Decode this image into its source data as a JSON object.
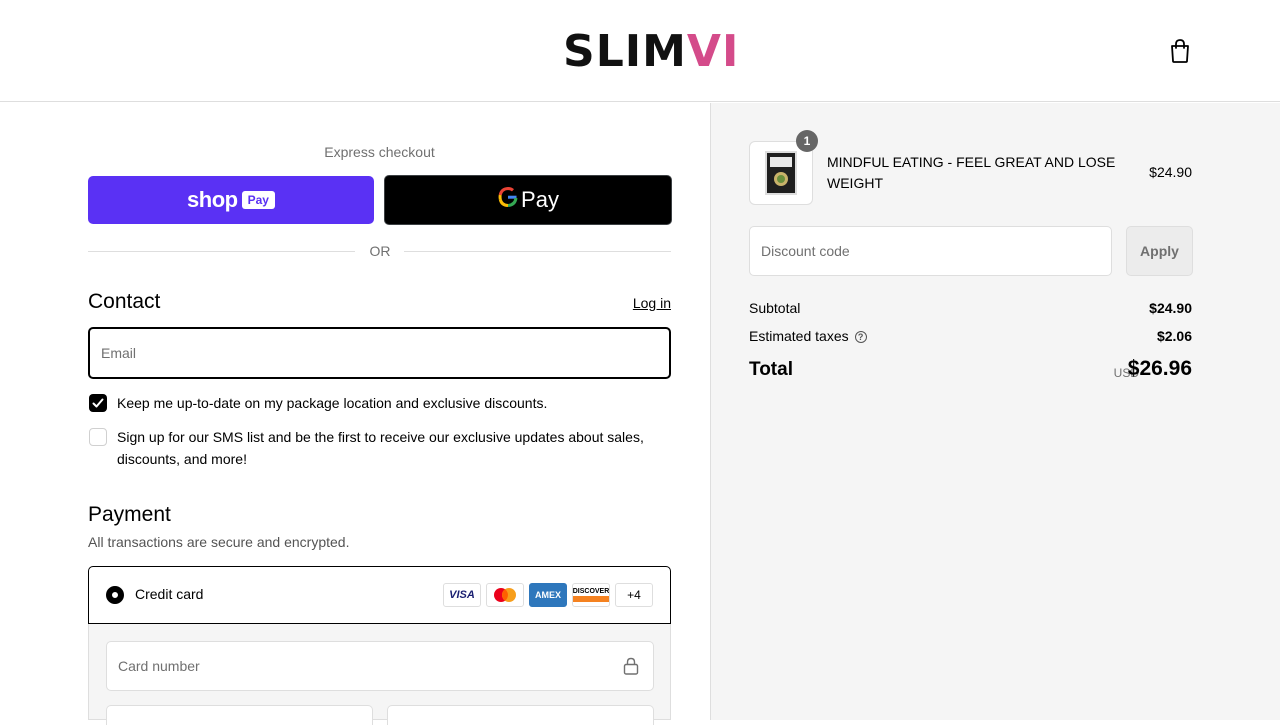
{
  "header": {
    "logo_part1": "SLIM",
    "logo_part2": "VI",
    "cart_icon": "shopping-bag-icon"
  },
  "express": {
    "label": "Express checkout",
    "shop_pay_text": "shop",
    "shop_pay_badge": "Pay",
    "gpay_g": "G",
    "gpay_text": "Pay",
    "or_text": "OR"
  },
  "contact": {
    "title": "Contact",
    "login_link": "Log in",
    "email_placeholder": "Email",
    "newsletter_label": "Keep me up-to-date on my package location and exclusive discounts.",
    "newsletter_checked": true,
    "sms_label_line1": "Sign up for our SMS list and be the first to receive our exclusive updates about sales,",
    "sms_label_line2": "discounts, and more!",
    "sms_checked": false
  },
  "payment": {
    "title": "Payment",
    "subtitle": "All transactions are secure and encrypted.",
    "method_label": "Credit card",
    "card_brands": [
      "VISA",
      "Mastercard",
      "AMEX",
      "DISCOVER"
    ],
    "more_brands": "+4",
    "card_number_placeholder": "Card number"
  },
  "summary": {
    "product_name_line1": "MINDFUL EATING - FEEL GREAT AND LOSE",
    "product_name_line2": "WEIGHT",
    "product_qty": "1",
    "product_price": "$24.90",
    "discount_placeholder": "Discount code",
    "apply_label": "Apply",
    "subtotal_label": "Subtotal",
    "subtotal_value": "$24.90",
    "taxes_label": "Estimated taxes",
    "taxes_value": "$2.06",
    "total_label": "Total",
    "currency": "USD",
    "total_value": "$26.96"
  },
  "colors": {
    "shop_pay": "#5a31f4",
    "logo_accent": "#d44b8a",
    "visa": "#1a1f71",
    "amex": "#2e77bc",
    "discover": "#f58220"
  }
}
